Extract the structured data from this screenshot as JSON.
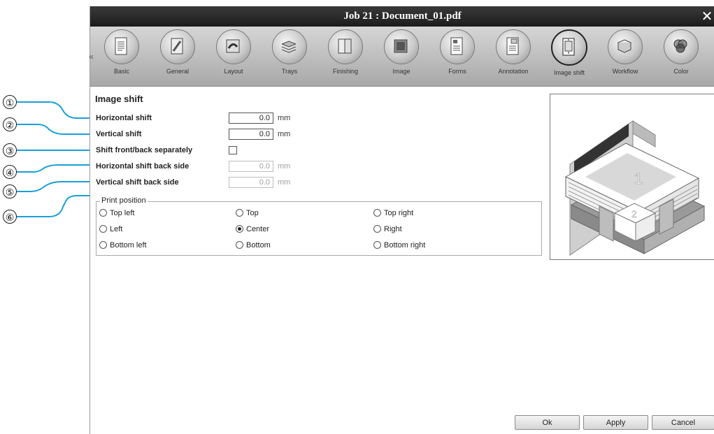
{
  "callouts": [
    "①",
    "②",
    "③",
    "④",
    "⑤",
    "⑥"
  ],
  "window": {
    "title": "Job 21 : Document_01.pdf",
    "close_glyph": "✕"
  },
  "toolbar": {
    "scroll_left": "«",
    "items": [
      {
        "label": "Basic",
        "icon": "basic-icon"
      },
      {
        "label": "General",
        "icon": "general-icon"
      },
      {
        "label": "Layout",
        "icon": "layout-icon"
      },
      {
        "label": "Trays",
        "icon": "trays-icon"
      },
      {
        "label": "Finishing",
        "icon": "finishing-icon"
      },
      {
        "label": "Image",
        "icon": "image-icon"
      },
      {
        "label": "Forms",
        "icon": "forms-icon"
      },
      {
        "label": "Annotation",
        "icon": "annotation-icon"
      },
      {
        "label": "Image shift",
        "icon": "image-shift-icon",
        "active": true
      },
      {
        "label": "Workflow",
        "icon": "workflow-icon"
      },
      {
        "label": "Color",
        "icon": "color-icon"
      }
    ]
  },
  "section": {
    "title": "Image shift",
    "horizontal_shift": {
      "label": "Horizontal shift",
      "value": "0.0",
      "unit": "mm"
    },
    "vertical_shift": {
      "label": "Vertical shift",
      "value": "0.0",
      "unit": "mm"
    },
    "separately": {
      "label": "Shift front/back separately",
      "checked": false
    },
    "horizontal_back": {
      "label": "Horizontal shift back side",
      "value": "0.0",
      "unit": "mm",
      "disabled": true
    },
    "vertical_back": {
      "label": "Vertical shift back side",
      "value": "0.0",
      "unit": "mm",
      "disabled": true
    }
  },
  "print_position": {
    "legend": "Print position",
    "options": [
      {
        "label": "Top left",
        "checked": false
      },
      {
        "label": "Top",
        "checked": false
      },
      {
        "label": "Top right",
        "checked": false
      },
      {
        "label": "Left",
        "checked": false
      },
      {
        "label": "Center",
        "checked": true
      },
      {
        "label": "Right",
        "checked": false
      },
      {
        "label": "Bottom left",
        "checked": false
      },
      {
        "label": "Bottom",
        "checked": false
      },
      {
        "label": "Bottom right",
        "checked": false
      }
    ]
  },
  "preview": {
    "front_label": "1",
    "back_label": "2"
  },
  "buttons": {
    "ok": "Ok",
    "apply": "Apply",
    "cancel": "Cancel"
  }
}
